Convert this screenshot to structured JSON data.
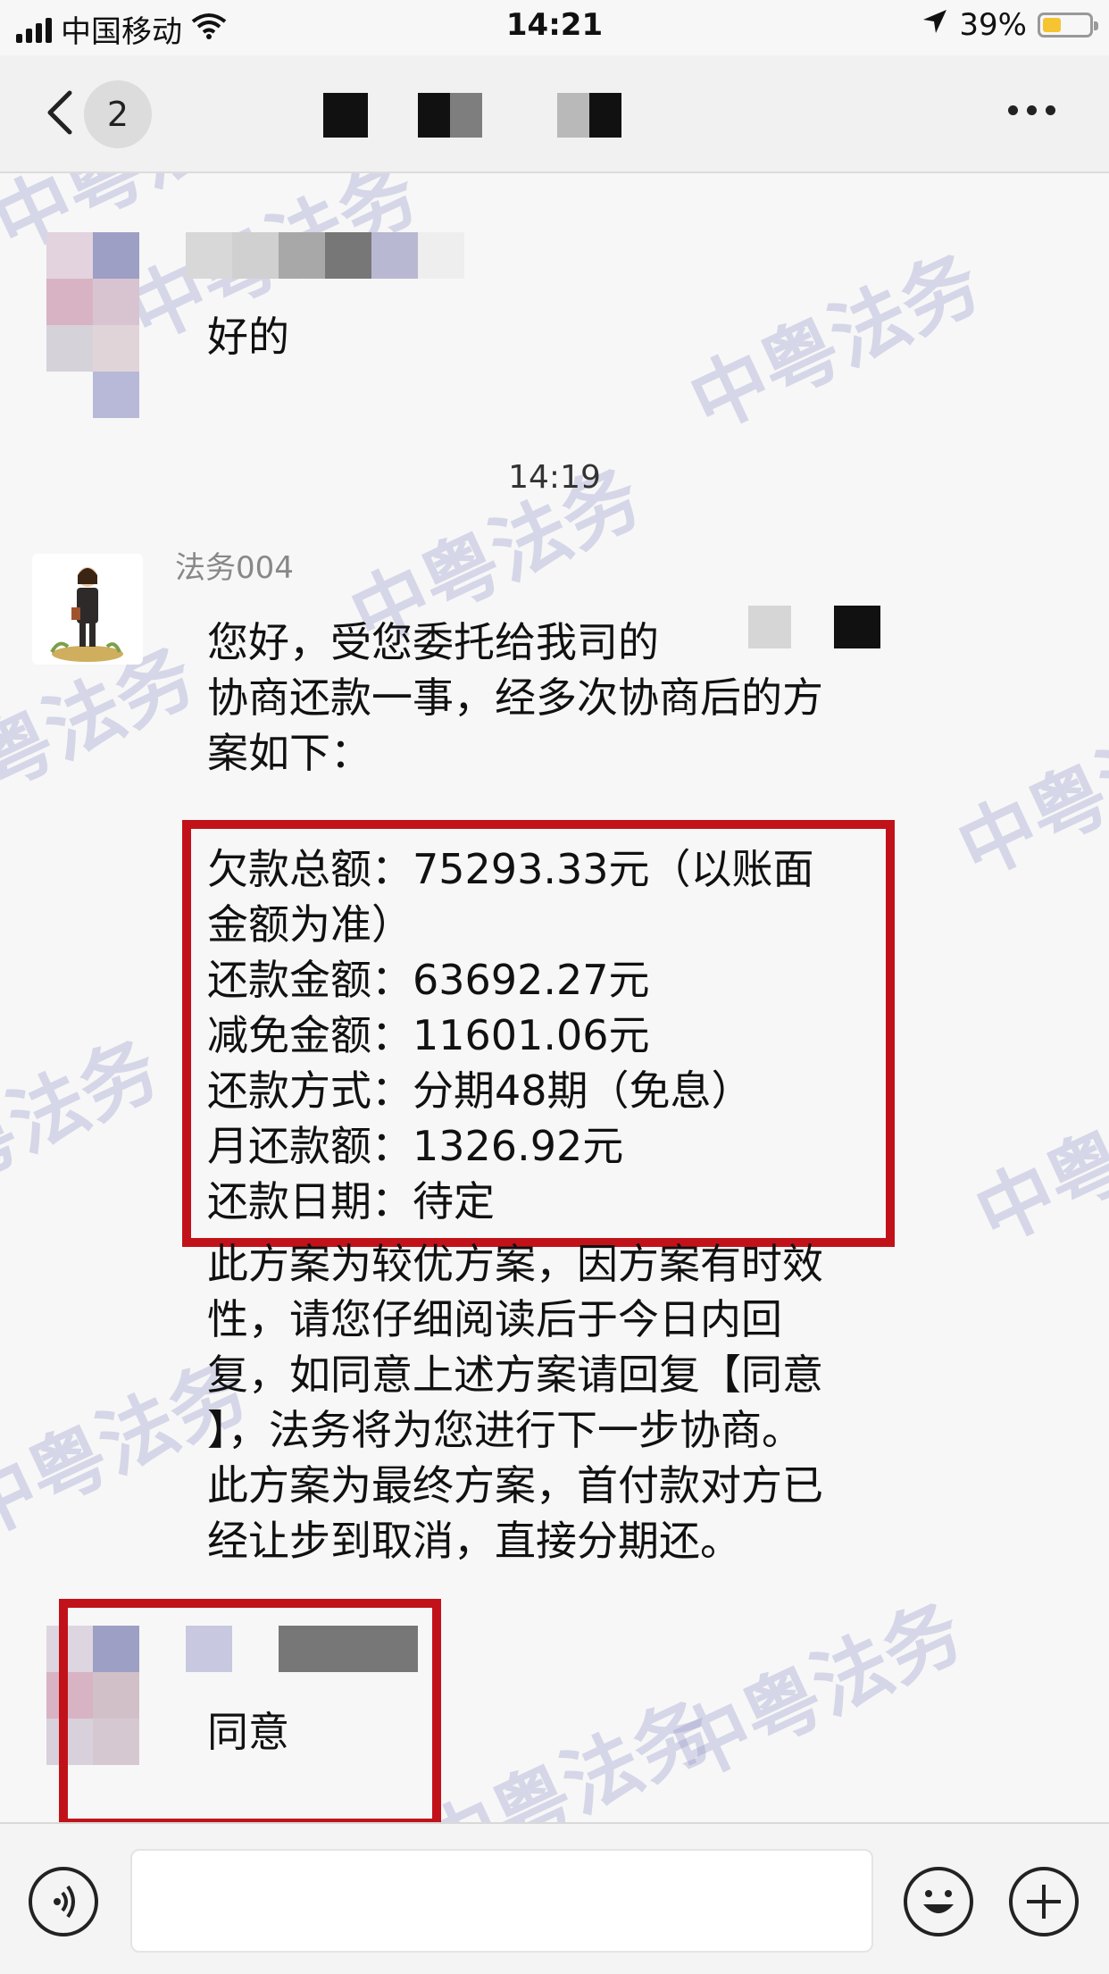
{
  "status_bar": {
    "carrier": "中国移动",
    "time": "14:21",
    "battery": "39%",
    "battery_level": 0.39,
    "icons": [
      "signal-icon",
      "wifi-icon",
      "location-arrow-icon",
      "battery-icon"
    ]
  },
  "nav": {
    "unread_count": "2",
    "title_redacted": true,
    "icons": [
      "chevron-left-icon",
      "more-icon"
    ]
  },
  "watermark": "中粤法务",
  "messages": [
    {
      "id": "m1",
      "side": "left",
      "sender_redacted": true,
      "text": "好的"
    },
    {
      "id": "ts",
      "type": "timestamp",
      "text": "14:19"
    },
    {
      "id": "m2",
      "side": "left",
      "sender": "法务004",
      "intro_lines": [
        "您好，受您委托给我司的",
        "协商还款一事，经多次协商后的方",
        "案如下："
      ],
      "plan_lines": [
        "欠款总额：75293.33元（以账面",
        "金额为准）",
        "还款金额：63692.27元",
        "减免金额：11601.06元",
        "还款方式：分期48期（免息）",
        "月还款额：1326.92元",
        "还款日期：待定"
      ],
      "closing_lines": [
        "此方案为较优方案，因方案有时效",
        "性，请您仔细阅读后于今日内回",
        "复，如同意上述方案请回复【同意",
        "】，法务将为您进行下一步协商。",
        "此方案为最终方案，首付款对方已",
        "经让步到取消，直接分期还。"
      ]
    },
    {
      "id": "m3",
      "side": "left",
      "sender_redacted": true,
      "text": "同意"
    }
  ],
  "input_bar": {
    "icons": [
      "voice-icon",
      "emoji-icon",
      "plus-icon"
    ],
    "input_value": ""
  },
  "colors": {
    "highlight_box": "#c1121a",
    "watermark": "#9698c8",
    "battery": "#f6c430"
  }
}
